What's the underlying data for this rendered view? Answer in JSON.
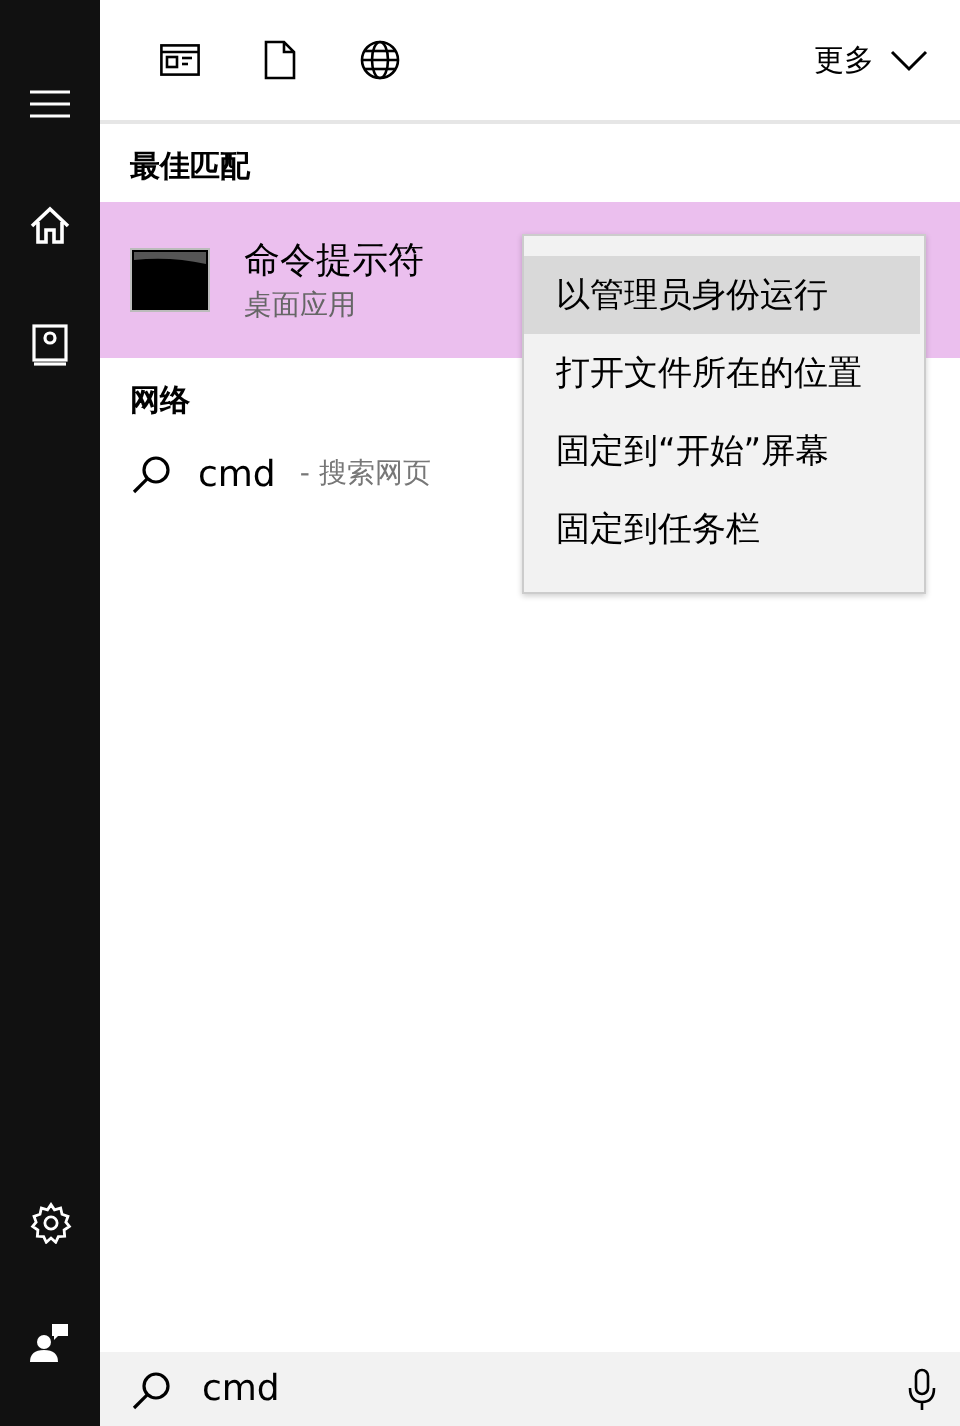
{
  "toolbar": {
    "more_label": "更多"
  },
  "best_match": {
    "heading": "最佳匹配",
    "result": {
      "title": "命令提示符",
      "subtitle": "桌面应用",
      "selected": true
    }
  },
  "web": {
    "heading": "网络",
    "item": {
      "query": "cmd",
      "suffix": "- 搜索网页"
    }
  },
  "context_menu": [
    {
      "label": "以管理员身份运行",
      "selected": true
    },
    {
      "label": "打开文件所在的位置",
      "selected": false
    },
    {
      "label": "固定到“开始”屏幕",
      "selected": false
    },
    {
      "label": "固定到任务栏",
      "selected": false
    }
  ],
  "search": {
    "value": "cmd"
  }
}
